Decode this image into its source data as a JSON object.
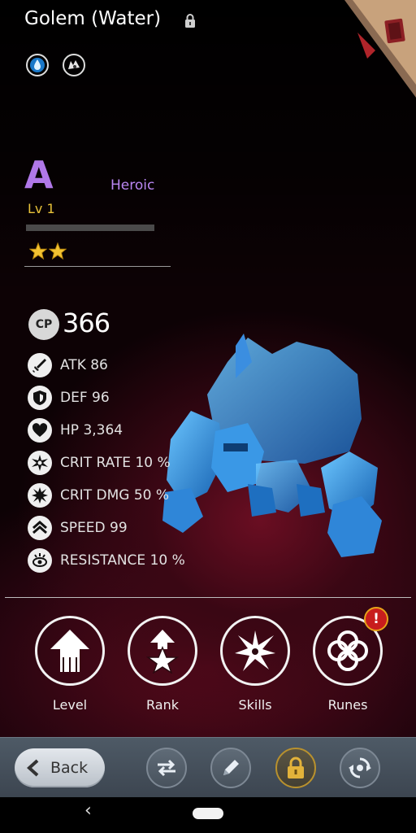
{
  "header": {
    "title": "Golem (Water)",
    "element_icons": [
      "water-element-icon",
      "beast-type-icon"
    ],
    "locked": true
  },
  "monster": {
    "grade": "A",
    "rarity": "Heroic",
    "level": "Lv 1",
    "xp_progress": 0,
    "stars": 2
  },
  "stats": {
    "cp_label": "CP",
    "cp_value": "366",
    "rows": [
      {
        "icon": "sword-icon",
        "text": "ATK 86"
      },
      {
        "icon": "shield-icon",
        "text": "DEF 96"
      },
      {
        "icon": "heart-icon",
        "text": "HP 3,364"
      },
      {
        "icon": "crit-rate-icon",
        "text": "CRIT RATE 10 %"
      },
      {
        "icon": "crit-dmg-icon",
        "text": "CRIT DMG 50 %"
      },
      {
        "icon": "speed-icon",
        "text": "SPEED 99"
      },
      {
        "icon": "resistance-icon",
        "text": "RESISTANCE 10 %"
      }
    ]
  },
  "actions": [
    {
      "label": "Level",
      "icon": "level-up-arrow-icon"
    },
    {
      "label": "Rank",
      "icon": "rank-star-icon"
    },
    {
      "label": "Skills",
      "icon": "skills-burst-icon"
    },
    {
      "label": "Runes",
      "icon": "runes-icon",
      "alert": "!"
    }
  ],
  "toolbar": {
    "back_label": "Back",
    "buttons": [
      "swap-icon",
      "pencil-icon",
      "lock-icon",
      "recycle-icon"
    ]
  },
  "colors": {
    "grade": "#b078e8",
    "rarity": "#b987f2",
    "level": "#e8c23a",
    "alert": "#c81d1d"
  }
}
